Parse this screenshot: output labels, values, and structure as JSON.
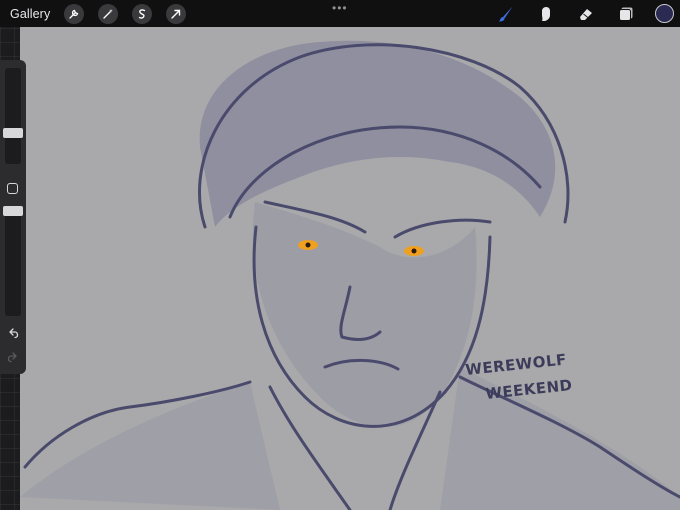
{
  "topbar": {
    "gallery_label": "Gallery",
    "left_tools": [
      "wrench-icon",
      "magic-wand-icon",
      "selection-icon",
      "transform-arrow-icon"
    ],
    "more_dots": "•••"
  },
  "right_tools": [
    "brush-icon",
    "smudge-icon",
    "eraser-icon",
    "layers-icon"
  ],
  "colors": {
    "active_color": "#2b2a52",
    "brush_blue": "#3d6fe0",
    "canvas_bg": "#a9a9ab",
    "ink": "#3b3b5a",
    "eye_glow": "#f0a020"
  },
  "sidebar": {
    "brush_size_level": 0.3,
    "opacity_level": 0.1
  },
  "artwork": {
    "caption_line1": "WEREWOLF",
    "caption_line2": "WEEKEND"
  }
}
